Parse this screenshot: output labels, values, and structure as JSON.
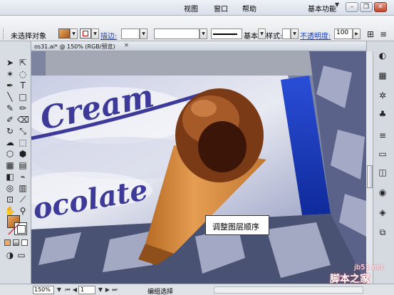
{
  "menu": {
    "items": [
      "视图",
      "窗口",
      "帮助"
    ],
    "workspace_label": "基本功能"
  },
  "controlbar": {
    "selection_label": "未选择对象",
    "stroke_label": "描边:",
    "brush_label": "基本",
    "style_label": "样式:",
    "opacity_label": "不透明度:",
    "opacity_value": "100"
  },
  "document": {
    "tab_title": "os31.ai* @ 150% (RGB/预览)"
  },
  "artwork": {
    "text_top": "Cream",
    "text_bottom": "ocolate"
  },
  "callout": {
    "text": "调整图层顺序"
  },
  "statusbar": {
    "zoom": "150%",
    "page": "1",
    "status_text": "编组选择"
  },
  "watermark": {
    "text": "脚本之家",
    "url": "jb51.net"
  },
  "colors": {
    "fill": "#d4843a",
    "ui_bg": "#d4d0c8",
    "accent_blue": "#1a3fbf"
  }
}
